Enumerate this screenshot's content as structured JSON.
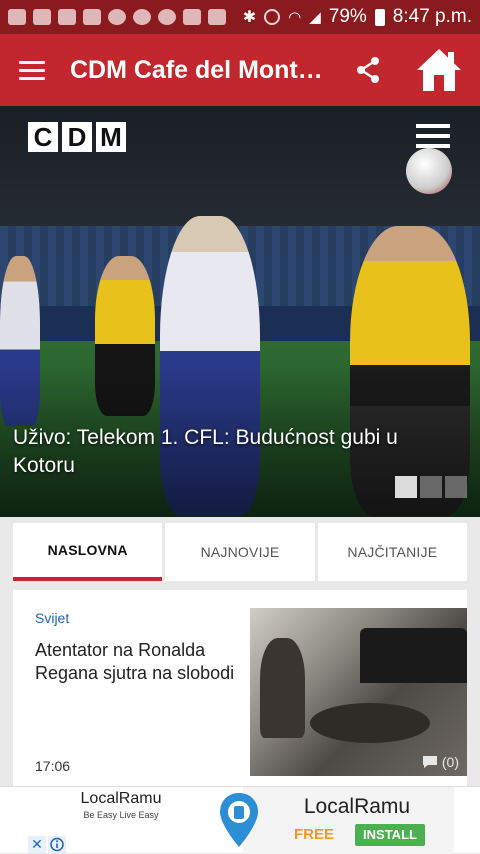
{
  "status_bar": {
    "battery_percent": "79%",
    "time": "8:47 p.m."
  },
  "app_bar": {
    "title": "CDM Cafe del Mont…"
  },
  "hero": {
    "logo_letters": [
      "C",
      "D",
      "M"
    ],
    "caption": "Uživo: Telekom 1. CFL: Budućnost gubi u Kotoru",
    "slides": 3,
    "active_slide": 1
  },
  "tabs": [
    {
      "label": "NASLOVNA",
      "active": true
    },
    {
      "label": "NAJNOVIJE",
      "active": false
    },
    {
      "label": "NAJČITANIJE",
      "active": false
    }
  ],
  "article": {
    "category": "Svijet",
    "headline": "Atentator na Ronalda Regana sjutra na slobodi",
    "time": "17:06",
    "comments": "(0)"
  },
  "ad": {
    "brand": "LocalRamu",
    "tagline": "Be Easy Live Easy",
    "brand_large": "LocalRamu",
    "free_label": "FREE",
    "install_label": "INSTALL",
    "close_label": "✕"
  },
  "colors": {
    "primary": "#c1272d",
    "status_bar": "#8a1a1e",
    "link_blue": "#1e63b8",
    "install_green": "#4caf50",
    "free_orange": "#f39a1e"
  }
}
